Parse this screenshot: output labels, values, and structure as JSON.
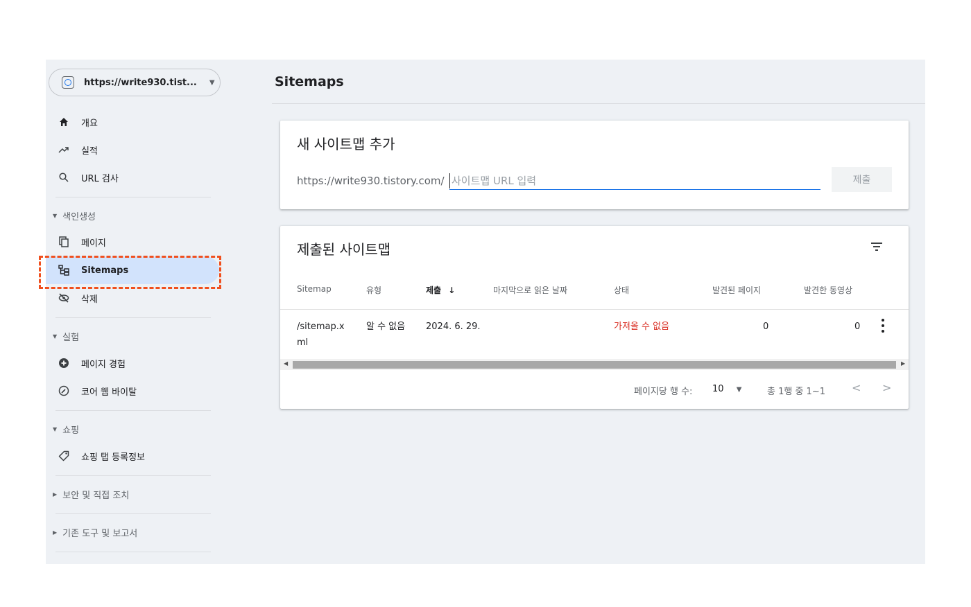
{
  "property": {
    "url": "https://write930.tist..."
  },
  "nav": {
    "overview": "개요",
    "performance": "실적",
    "url_inspection": "URL 검사",
    "indexing_header": "색인생성",
    "pages": "페이지",
    "sitemaps": "Sitemaps",
    "removals": "삭제",
    "experience_header": "실험",
    "page_experience": "페이지 경험",
    "core_web_vitals": "코어 웹 바이탈",
    "shopping_header": "쇼핑",
    "shopping_tab": "쇼핑 탭 등록정보",
    "security_header": "보안 및 직접 조치",
    "legacy_header": "기존 도구 및 보고서"
  },
  "main": {
    "title": "Sitemaps"
  },
  "add_sitemap": {
    "title": "새 사이트맵 추가",
    "prefix": "https://write930.tistory.com/",
    "placeholder": "사이트맵 URL 입력",
    "submit_label": "제출"
  },
  "submitted": {
    "title": "제출된 사이트맵",
    "columns": [
      "Sitemap",
      "유형",
      "제출",
      "마지막으로 읽은 날짜",
      "상태",
      "발견된 페이지",
      "발견한 동영상"
    ],
    "sort_arrow": "↓",
    "rows": [
      {
        "sitemap_line1": "/sitemap.x",
        "sitemap_line2": "ml",
        "type": "알 수 없음",
        "submitted": "2024. 6. 29.",
        "last_read": "",
        "status": "가져올 수 없음",
        "pages": "0",
        "videos": "0"
      }
    ],
    "pagination": {
      "rows_per_page_label": "페이지당 행 수:",
      "rows_per_page": "10",
      "range": "총 1행 중 1~1"
    }
  },
  "colors": {
    "accent": "#1a73e8",
    "active_bg": "#d2e3fc",
    "error": "#d93025",
    "highlight": "#f04f1d"
  }
}
